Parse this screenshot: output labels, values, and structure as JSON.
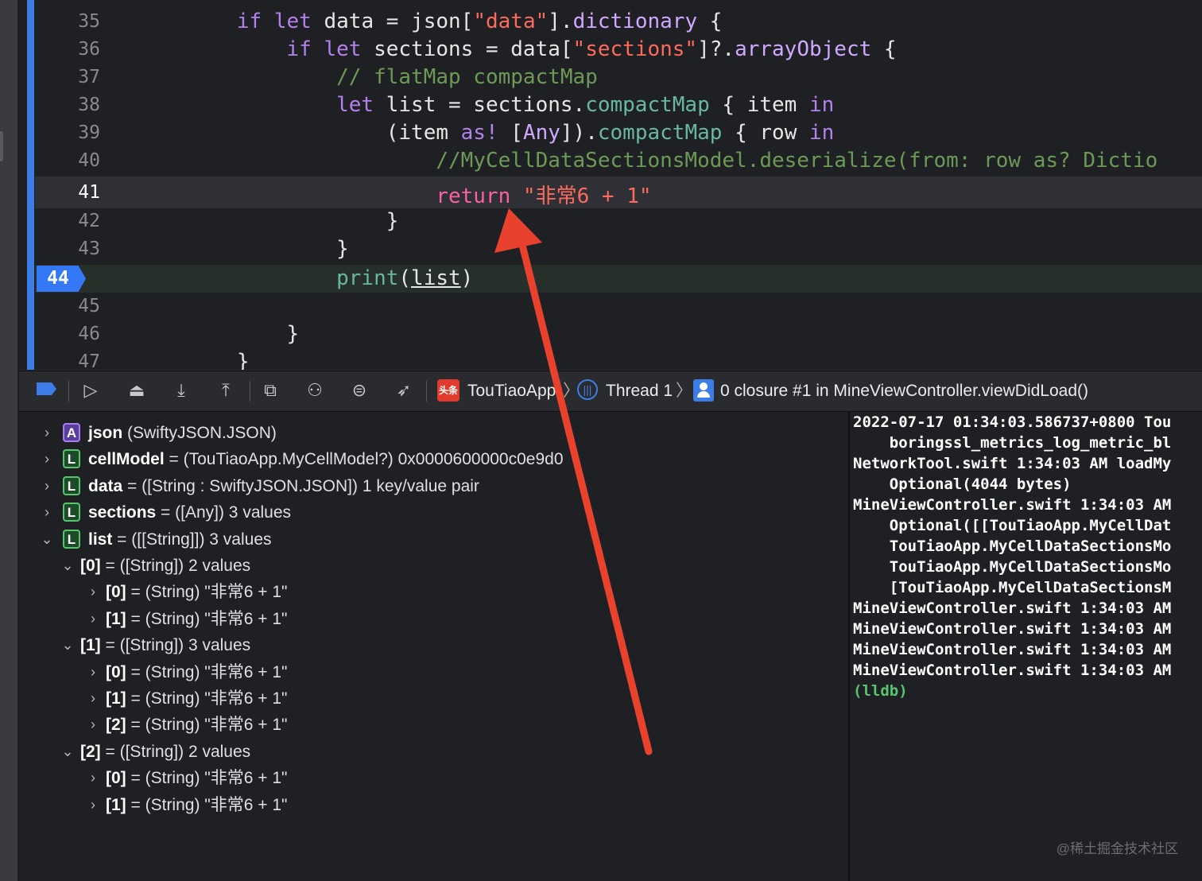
{
  "editor": {
    "lines": [
      {
        "num": "35",
        "segs": [
          [
            "if ",
            "kw2"
          ],
          [
            "let ",
            "kw2"
          ],
          [
            "data = json[",
            ""
          ],
          [
            "\"data\"",
            "str"
          ],
          [
            "].",
            ""
          ],
          [
            "dictionary",
            "ty"
          ],
          [
            " {",
            ""
          ]
        ],
        "indent": "         "
      },
      {
        "num": "36",
        "segs": [
          [
            "if ",
            "kw2"
          ],
          [
            "let ",
            "kw2"
          ],
          [
            "sections = data[",
            ""
          ],
          [
            "\"sections\"",
            "str"
          ],
          [
            "]?.",
            ""
          ],
          [
            "arrayObject",
            "ty"
          ],
          [
            " {",
            ""
          ]
        ],
        "indent": "             "
      },
      {
        "num": "37",
        "segs": [
          [
            "// flatMap compactMap",
            "cmt"
          ]
        ],
        "indent": "                 "
      },
      {
        "num": "38",
        "segs": [
          [
            "let ",
            "kw2"
          ],
          [
            "list = sections.",
            ""
          ],
          [
            "compactMap",
            "fn"
          ],
          [
            " { item ",
            ""
          ],
          [
            "in",
            "kw2"
          ]
        ],
        "indent": "                 "
      },
      {
        "num": "39",
        "segs": [
          [
            "(item ",
            ""
          ],
          [
            "as!",
            "kw2"
          ],
          [
            " [",
            ""
          ],
          [
            "Any",
            "ty"
          ],
          [
            "]).",
            ""
          ],
          [
            "compactMap",
            "fn"
          ],
          [
            " { row ",
            ""
          ],
          [
            "in",
            "kw2"
          ]
        ],
        "indent": "                     "
      },
      {
        "num": "40",
        "segs": [
          [
            "//MyCellDataSectionsModel.deserialize(from: row as? Dictio",
            "cmt"
          ]
        ],
        "indent": "                         "
      },
      {
        "num": "41",
        "segs": [
          [
            "return ",
            "kw"
          ],
          [
            "\"非常6 + 1\"",
            "str"
          ]
        ],
        "indent": "                         "
      },
      {
        "num": "42",
        "segs": [
          [
            "}",
            ""
          ]
        ],
        "indent": "                     "
      },
      {
        "num": "43",
        "segs": [
          [
            "}",
            ""
          ]
        ],
        "indent": "                 "
      },
      {
        "num": "44",
        "segs": [
          [
            "print",
            "fn"
          ],
          [
            "(",
            ""
          ],
          [
            "list",
            "u"
          ],
          [
            ")",
            ""
          ]
        ],
        "indent": "                 "
      },
      {
        "num": "45",
        "segs": [],
        "indent": ""
      },
      {
        "num": "46",
        "segs": [
          [
            "}",
            ""
          ]
        ],
        "indent": "             "
      },
      {
        "num": "47",
        "segs": [
          [
            "}",
            ""
          ]
        ],
        "indent": "         "
      }
    ],
    "current_line": "41",
    "breakpoint_line": "44"
  },
  "toolbar": {
    "app_icon_label": "头条",
    "app_name": "TouTiaoApp",
    "thread": "Thread 1",
    "frame": "0 closure #1 in MineViewController.viewDidLoad()",
    "icons": [
      "breakpoints-toggle-icon",
      "continue-icon",
      "step-over-icon",
      "step-into-icon",
      "step-out-icon",
      "view-hierarchy-icon",
      "memory-graph-icon",
      "environment-overrides-icon",
      "simulate-location-icon"
    ]
  },
  "variables": [
    {
      "chev": "›",
      "badge": "A",
      "name": "json",
      "rest": " (SwiftyJSON.JSON)",
      "level": 0
    },
    {
      "chev": "›",
      "badge": "L",
      "name": "cellModel",
      "rest": " = (TouTiaoApp.MyCellModel?) 0x0000600000c0e9d0",
      "level": 0
    },
    {
      "chev": "›",
      "badge": "L",
      "name": "data",
      "rest": " = ([String : SwiftyJSON.JSON]) 1 key/value pair",
      "level": 0
    },
    {
      "chev": "›",
      "badge": "L",
      "name": "sections",
      "rest": " = ([Any]) 3 values",
      "level": 0
    },
    {
      "chev": "⌄",
      "badge": "L",
      "name": "list",
      "rest": " = ([[String]]) 3 values",
      "level": 0
    },
    {
      "chev": "⌄",
      "badge": "",
      "name": "[0]",
      "rest": " = ([String]) 2 values",
      "level": 1
    },
    {
      "chev": "›",
      "badge": "",
      "name": "[0]",
      "rest": " = (String) \"非常6 + 1\"",
      "level": 2
    },
    {
      "chev": "›",
      "badge": "",
      "name": "[1]",
      "rest": " = (String) \"非常6 + 1\"",
      "level": 2
    },
    {
      "chev": "⌄",
      "badge": "",
      "name": "[1]",
      "rest": " = ([String]) 3 values",
      "level": 1
    },
    {
      "chev": "›",
      "badge": "",
      "name": "[0]",
      "rest": " = (String) \"非常6 + 1\"",
      "level": 2
    },
    {
      "chev": "›",
      "badge": "",
      "name": "[1]",
      "rest": " = (String) \"非常6 + 1\"",
      "level": 2
    },
    {
      "chev": "›",
      "badge": "",
      "name": "[2]",
      "rest": " = (String) \"非常6 + 1\"",
      "level": 2
    },
    {
      "chev": "⌄",
      "badge": "",
      "name": "[2]",
      "rest": " = ([String]) 2 values",
      "level": 1
    },
    {
      "chev": "›",
      "badge": "",
      "name": "[0]",
      "rest": " = (String) \"非常6 + 1\"",
      "level": 2
    },
    {
      "chev": "›",
      "badge": "",
      "name": "[1]",
      "rest": " = (String) \"非常6 + 1\"",
      "level": 2
    }
  ],
  "console": {
    "lines": [
      "2022-07-17 01:34:03.586737+0800 Tou",
      "    boringssl_metrics_log_metric_bl",
      "NetworkTool.swift 1:34:03 AM loadMy",
      "    Optional(4044 bytes)",
      "MineViewController.swift 1:34:03 AM",
      "    Optional([[TouTiaoApp.MyCellDat",
      "    TouTiaoApp.MyCellDataSectionsMo",
      "    TouTiaoApp.MyCellDataSectionsMo",
      "    [TouTiaoApp.MyCellDataSectionsM",
      "MineViewController.swift 1:34:03 AM",
      "MineViewController.swift 1:34:03 AM",
      "MineViewController.swift 1:34:03 AM",
      "MineViewController.swift 1:34:03 AM"
    ],
    "prompt": "(lldb)"
  },
  "watermark": "@稀土掘金技术社区",
  "colors": {
    "accent": "#3d7de8",
    "arrow": "#e8422f",
    "keyword": "#b281eb",
    "string": "#fc6a5d",
    "comment": "#6c9a56"
  }
}
